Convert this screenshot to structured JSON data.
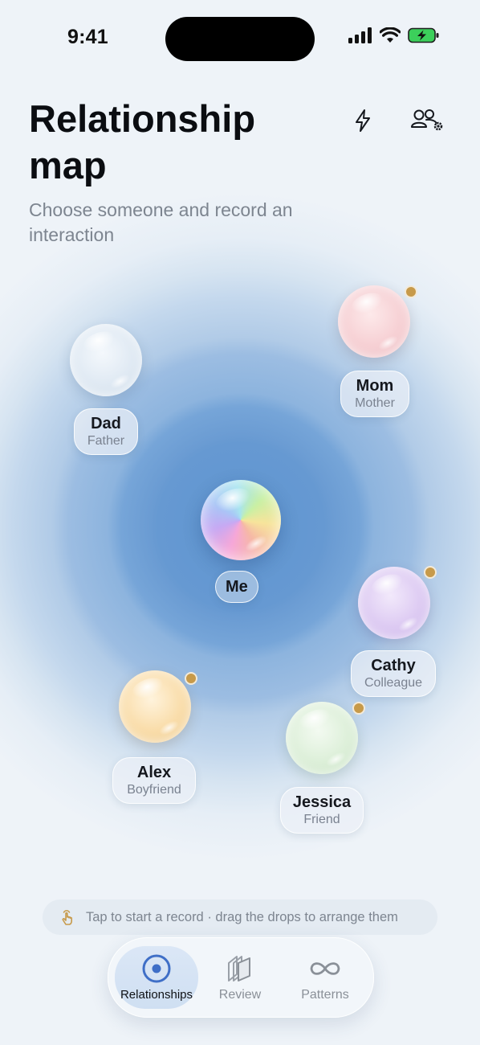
{
  "status_bar": {
    "time": "9:41"
  },
  "header": {
    "title": "Relationship map",
    "subtitle": "Choose someone and record an interaction"
  },
  "center": {
    "name": "Me"
  },
  "people": [
    {
      "name": "Dad",
      "role": "Father",
      "has_dot": false
    },
    {
      "name": "Mom",
      "role": "Mother",
      "has_dot": true
    },
    {
      "name": "Cathy",
      "role": "Colleague",
      "has_dot": true
    },
    {
      "name": "Alex",
      "role": "Boyfriend",
      "has_dot": true
    },
    {
      "name": "Jessica",
      "role": "Friend",
      "has_dot": true
    }
  ],
  "hint": {
    "text": "Tap to start a record · drag the drops to arrange them"
  },
  "tabs": [
    {
      "label": "Relationships",
      "icon": "target-icon",
      "active": true
    },
    {
      "label": "Review",
      "icon": "layers-icon",
      "active": false
    },
    {
      "label": "Patterns",
      "icon": "infinity-icon",
      "active": false
    }
  ],
  "colors": {
    "dot": "#c79a4a",
    "field_center": "#5f95d0",
    "accent": "#3f6fc7"
  }
}
